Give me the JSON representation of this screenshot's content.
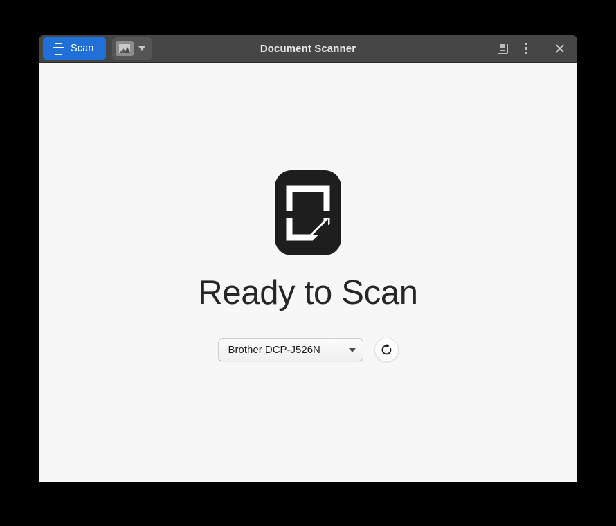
{
  "window": {
    "title": "Document Scanner"
  },
  "headerbar": {
    "scan_button_label": "Scan",
    "scan_icon": "scanner-icon",
    "mode_icon": "image-icon",
    "mode_chevron_icon": "chevron-down-icon",
    "save_icon": "save-floppy-icon",
    "menu_icon": "three-dots-vertical-icon",
    "close_icon": "close-x-icon"
  },
  "main": {
    "document_icon": "document-page-icon",
    "status_title": "Ready to Scan",
    "device": {
      "selected": "Brother DCP-J526N",
      "dropdown_icon": "chevron-down-icon",
      "refresh_icon": "refresh-icon"
    }
  },
  "colors": {
    "accent_blue": "#2070d8",
    "headerbar_bg": "#464646",
    "content_bg": "#f7f7f7",
    "icon_dark": "#1e1e1e",
    "title_text": "#e8e8e8"
  }
}
